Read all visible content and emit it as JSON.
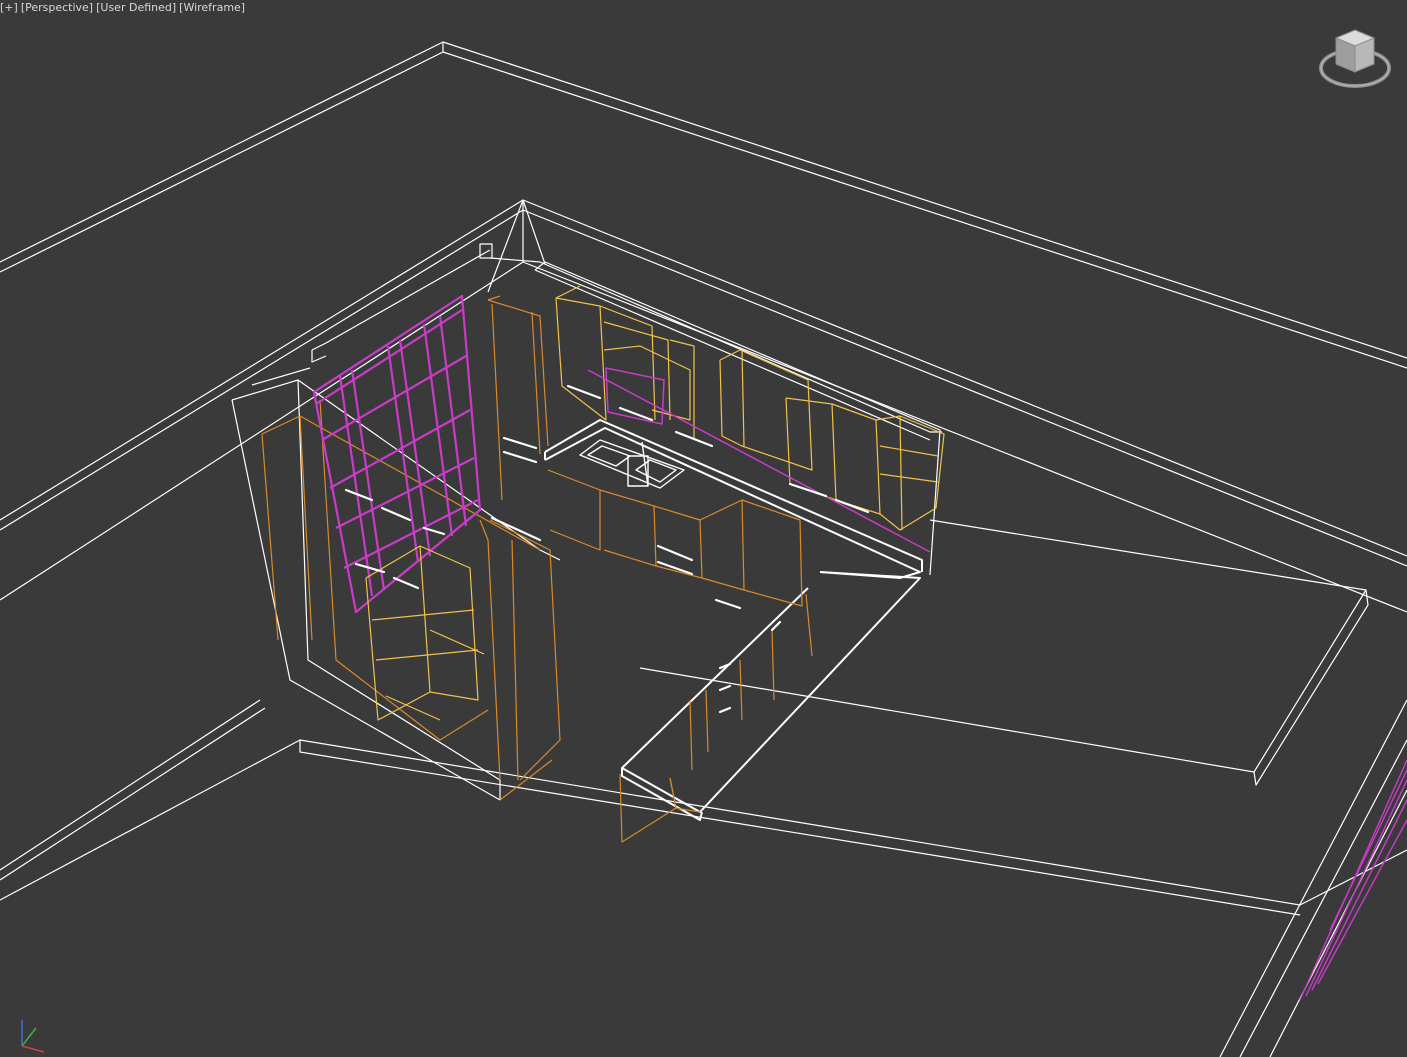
{
  "viewport": {
    "menu_label": "[+]",
    "view_label": "[Perspective]",
    "camera_label": "[User Defined]",
    "shading_label": "[Wireframe]"
  },
  "colors": {
    "background": "#3a3a3a",
    "wire_white": "#ffffff",
    "wire_orange": "#d98a2a",
    "wire_yellow": "#f0c24a",
    "wire_magenta": "#c83cc8"
  },
  "icons": {
    "viewcube": "viewcube-icon",
    "axis": "axis-tripod-icon"
  }
}
